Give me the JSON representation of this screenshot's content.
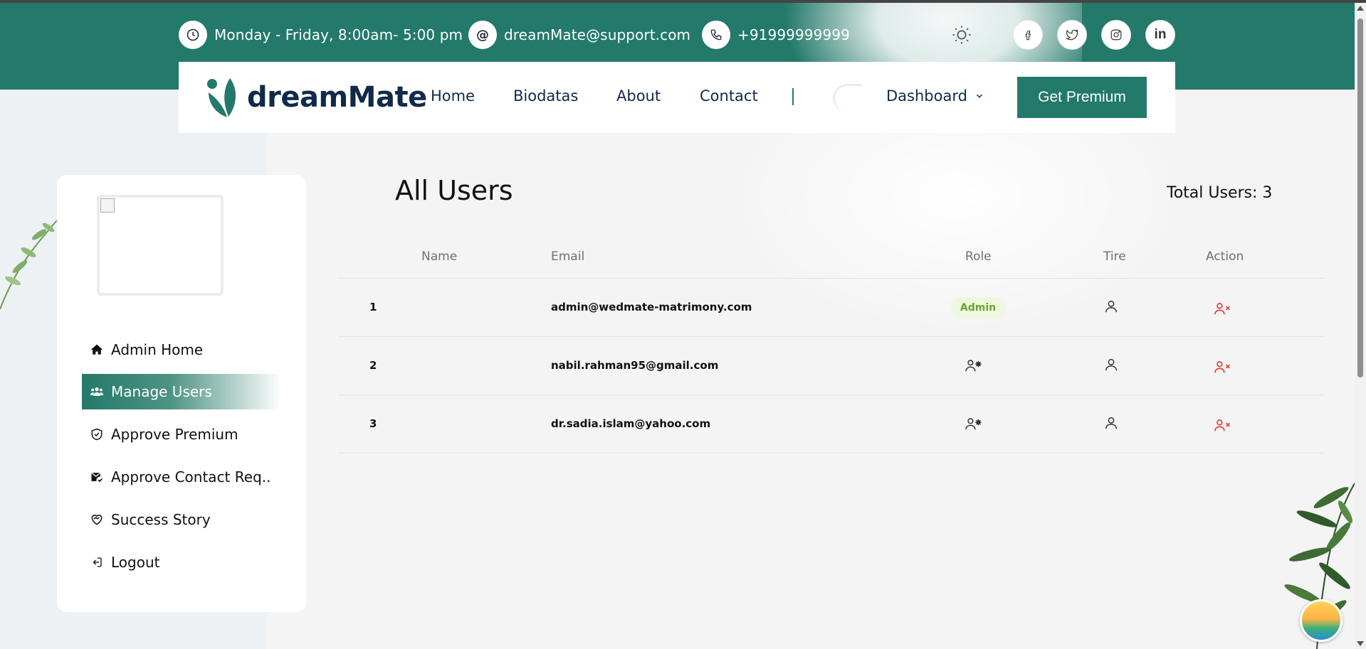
{
  "topbar": {
    "hours": "Monday - Friday, 8:00am- 5:00 pm",
    "email": "dreamMate@support.com",
    "phone": "+91999999999",
    "social": [
      "facebook-icon",
      "twitter-icon",
      "instagram-icon",
      "linkedin-icon"
    ]
  },
  "nav": {
    "brand": "dreamMate",
    "links": [
      "Home",
      "Biodatas",
      "About",
      "Contact"
    ],
    "dashboard": "Dashboard",
    "premium": "Get Premium"
  },
  "sidebar": {
    "items": [
      {
        "label": "Admin Home",
        "icon": "home-icon"
      },
      {
        "label": "Manage Users",
        "icon": "users-icon"
      },
      {
        "label": "Approve Premium",
        "icon": "shield-check-icon"
      },
      {
        "label": "Approve Contact Req..",
        "icon": "mail-check-icon"
      },
      {
        "label": "Success Story",
        "icon": "heart-handshake-icon"
      },
      {
        "label": "Logout",
        "icon": "logout-icon"
      }
    ]
  },
  "main": {
    "title": "All Users",
    "total": "Total Users: 3",
    "columns": [
      "Name",
      "Email",
      "Role",
      "Tire",
      "Action"
    ],
    "rows": [
      {
        "no": "1",
        "name": "",
        "email": "admin@wedmate-matrimony.com",
        "role": "Admin"
      },
      {
        "no": "2",
        "name": "",
        "email": "nabil.rahman95@gmail.com",
        "role": ""
      },
      {
        "no": "3",
        "name": "",
        "email": "dr.sadia.islam@yahoo.com",
        "role": ""
      }
    ]
  },
  "colors": {
    "brand": "#23796a",
    "navy": "#0f2a4a",
    "danger": "#e53935",
    "admin_badge_bg": "#eef8df",
    "admin_badge_text": "#6aa22b"
  }
}
